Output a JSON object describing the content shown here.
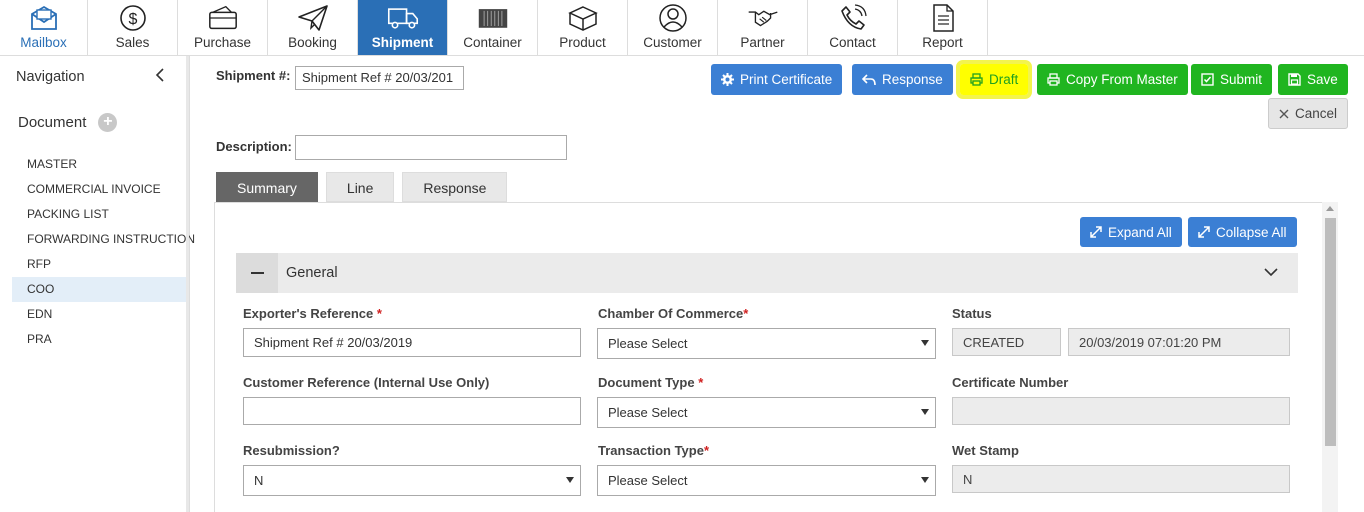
{
  "topnav": [
    {
      "label": "Mailbox",
      "icon": "envelope-icon"
    },
    {
      "label": "Sales",
      "icon": "dollar-icon"
    },
    {
      "label": "Purchase",
      "icon": "wallet-icon"
    },
    {
      "label": "Booking",
      "icon": "paper-plane-icon"
    },
    {
      "label": "Shipment",
      "icon": "truck-icon"
    },
    {
      "label": "Container",
      "icon": "container-icon"
    },
    {
      "label": "Product",
      "icon": "box-icon"
    },
    {
      "label": "Customer",
      "icon": "user-icon"
    },
    {
      "label": "Partner",
      "icon": "handshake-icon"
    },
    {
      "label": "Contact",
      "icon": "phone-icon"
    },
    {
      "label": "Report",
      "icon": "document-icon"
    }
  ],
  "sidebar": {
    "title": "Navigation",
    "section": "Document",
    "items": [
      "MASTER",
      "COMMERCIAL INVOICE",
      "PACKING LIST",
      "FORWARDING INSTRUCTION",
      "RFP",
      "COO",
      "EDN",
      "PRA"
    ],
    "active_item": "COO"
  },
  "header": {
    "shipment_label": "Shipment #:",
    "shipment_value": "Shipment Ref # 20/03/201",
    "description_label": "Description:",
    "description_value": ""
  },
  "actions": {
    "print_certificate": "Print Certificate",
    "response": "Response",
    "draft": "Draft",
    "copy_from_master": "Copy From Master",
    "submit": "Submit",
    "save": "Save",
    "cancel": "Cancel"
  },
  "tabs": [
    "Summary",
    "Line",
    "Response"
  ],
  "active_tab": "Summary",
  "panel": {
    "expand_all": "Expand All",
    "collapse_all": "Collapse All",
    "section_title": "General"
  },
  "form": {
    "exporters_reference": {
      "label": "Exporter's Reference",
      "value": "Shipment Ref # 20/03/2019"
    },
    "chamber_of_commerce": {
      "label": "Chamber Of Commerce",
      "value": "Please Select"
    },
    "status": {
      "label": "Status",
      "value": "CREATED",
      "datetime": "20/03/2019 07:01:20 PM"
    },
    "customer_reference": {
      "label": "Customer Reference",
      "label_suffix": "(Internal Use Only)",
      "value": ""
    },
    "document_type": {
      "label": "Document Type",
      "value": "Please Select"
    },
    "certificate_number": {
      "label": "Certificate Number",
      "value": ""
    },
    "resubmission": {
      "label": "Resubmission?",
      "value": "N"
    },
    "transaction_type": {
      "label": "Transaction Type",
      "value": "Please Select"
    },
    "wet_stamp": {
      "label": "Wet Stamp",
      "value": "N"
    }
  },
  "colors": {
    "primary_blue": "#2a6fb6",
    "button_blue": "#3b7fd4",
    "button_green": "#20b520",
    "highlight_yellow": "#ffff00",
    "required_red": "#d02020"
  }
}
